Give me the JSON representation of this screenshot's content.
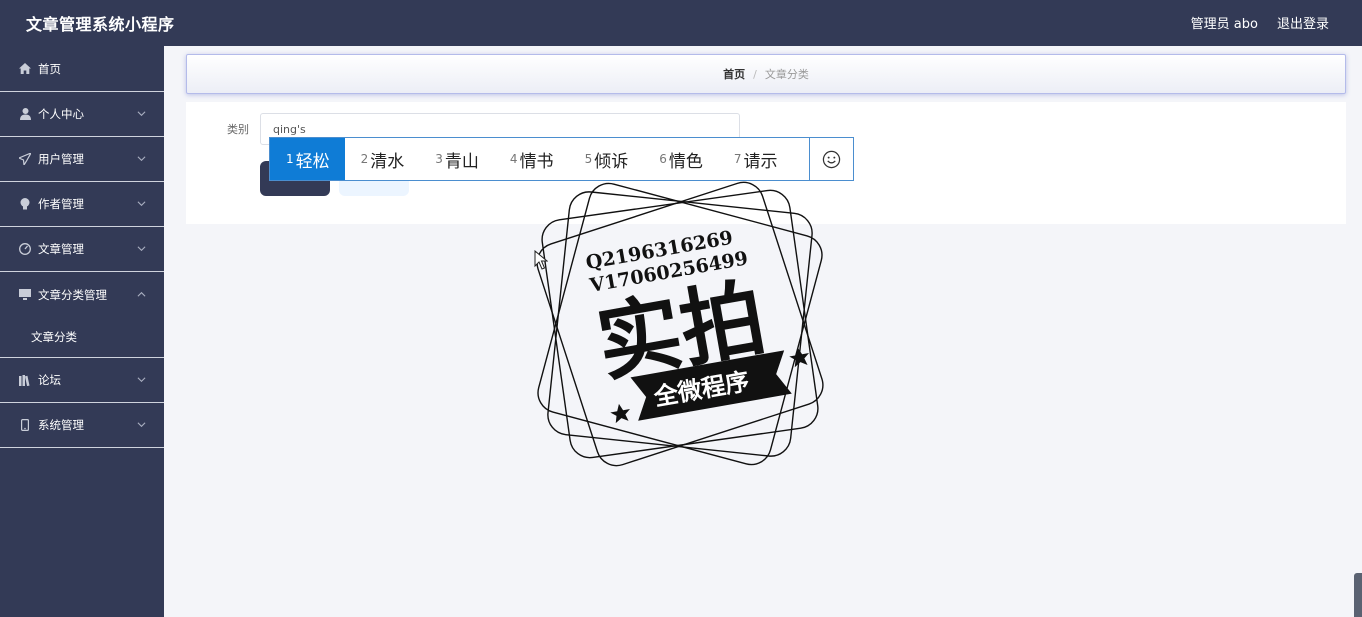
{
  "header": {
    "app_title": "文章管理系统小程序",
    "admin_label": "管理员 abo",
    "logout_label": "退出登录"
  },
  "sidebar": {
    "items": [
      {
        "label": "首页",
        "icon": "home-icon"
      },
      {
        "label": "个人中心",
        "icon": "user-icon"
      },
      {
        "label": "用户管理",
        "icon": "send-icon"
      },
      {
        "label": "作者管理",
        "icon": "bulb-icon"
      },
      {
        "label": "文章管理",
        "icon": "dashboard-icon"
      },
      {
        "label": "文章分类管理",
        "icon": "monitor-icon",
        "expanded": true
      },
      {
        "label": "论坛",
        "icon": "books-icon"
      },
      {
        "label": "系统管理",
        "icon": "phone-icon"
      }
    ],
    "submenu": {
      "label": "文章分类"
    }
  },
  "breadcrumb": {
    "home": "首页",
    "separator": "/",
    "current": "文章分类"
  },
  "form": {
    "field_label": "类别",
    "field_value": "qing's"
  },
  "ime": {
    "candidates": [
      {
        "num": "1",
        "text": "轻松"
      },
      {
        "num": "2",
        "text": "清水"
      },
      {
        "num": "3",
        "text": "青山"
      },
      {
        "num": "4",
        "text": "情书"
      },
      {
        "num": "5",
        "text": "倾诉"
      },
      {
        "num": "6",
        "text": "情色"
      },
      {
        "num": "7",
        "text": "请示"
      }
    ],
    "emoji_icon": "smiley-icon"
  },
  "watermark": {
    "line1": "Q2196316269",
    "line2": "V17060256499",
    "main": "实拍",
    "banner": "全微程序"
  },
  "colors": {
    "primary": "#333a56",
    "ime_active": "#0f7cd6",
    "link": "#409eff"
  }
}
